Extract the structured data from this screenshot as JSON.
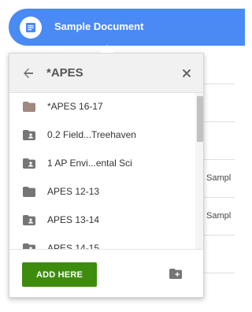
{
  "header": {
    "title": "Sample Document",
    "color": "#4a8af4"
  },
  "background": {
    "row_texts": [
      "Sampl",
      "Sampl"
    ]
  },
  "popup": {
    "title": "*APES",
    "back_icon": "arrow-left-icon",
    "close_icon": "close-icon",
    "items": [
      {
        "label": "*APES 16-17",
        "icon": "folder-icon",
        "color": "#a1887f"
      },
      {
        "label": "0.2 Field...Treehaven",
        "icon": "shared-folder-icon",
        "color": "#757575"
      },
      {
        "label": "1 AP Envi...ental Sci",
        "icon": "shared-folder-icon",
        "color": "#757575"
      },
      {
        "label": "APES 12-13",
        "icon": "folder-icon",
        "color": "#757575"
      },
      {
        "label": "APES 13-14",
        "icon": "shared-folder-icon",
        "color": "#757575"
      },
      {
        "label": "APES 14-15",
        "icon": "shared-folder-icon",
        "color": "#757575"
      }
    ],
    "add_button_label": "ADD HERE",
    "add_button_color": "#3d8c0e",
    "new_folder_icon": "new-folder-icon"
  }
}
